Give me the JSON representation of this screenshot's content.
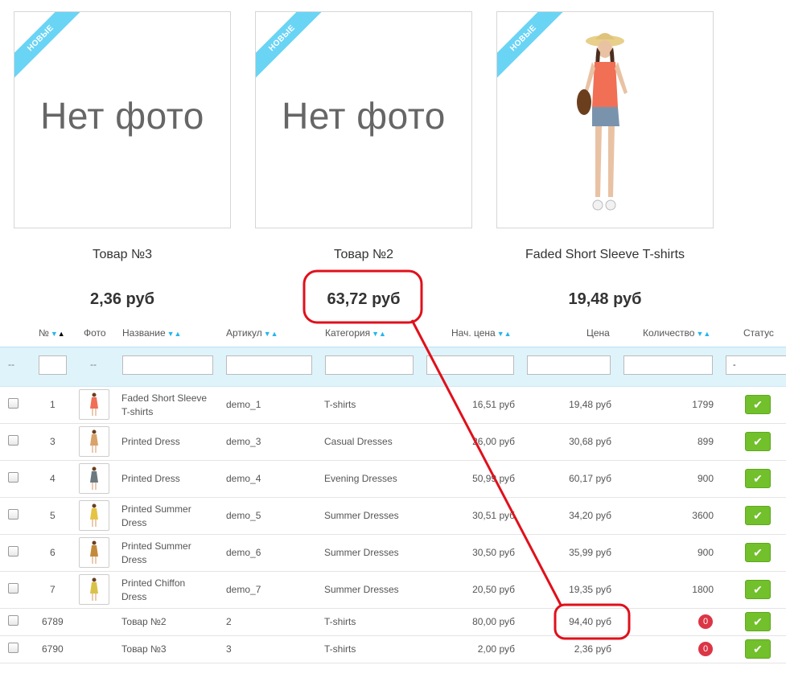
{
  "ribbon_label": "НОВЫЕ",
  "cards": [
    {
      "name": "Товар №3",
      "price": "2,36 руб",
      "photo": "Нет фото"
    },
    {
      "name": "Товар №2",
      "price": "63,72 руб",
      "photo": "Нет фото"
    },
    {
      "name": "Faded Short Sleeve T-shirts",
      "price": "19,48 руб",
      "photo": ""
    }
  ],
  "table": {
    "headers": {
      "num": "№",
      "photo": "Фото",
      "name": "Название",
      "sku": "Артикул",
      "category": "Категория",
      "base_price": "Нач. цена",
      "price": "Цена",
      "quantity": "Количество",
      "status": "Статус"
    },
    "filter": {
      "dash1": "--",
      "dash2": "--",
      "status": "-"
    },
    "rows": [
      {
        "id": "1",
        "name1": "Faded Short Sleeve",
        "name2": "T-shirts",
        "sku": "demo_1",
        "category": "T-shirts",
        "base": "16,51 руб",
        "price": "19,48 руб",
        "qty": "1799"
      },
      {
        "id": "3",
        "name1": "Printed Dress",
        "name2": "",
        "sku": "demo_3",
        "category": "Casual Dresses",
        "base": "26,00 руб",
        "price": "30,68 руб",
        "qty": "899"
      },
      {
        "id": "4",
        "name1": "Printed Dress",
        "name2": "",
        "sku": "demo_4",
        "category": "Evening Dresses",
        "base": "50,99 руб",
        "price": "60,17 руб",
        "qty": "900"
      },
      {
        "id": "5",
        "name1": "Printed Summer",
        "name2": "Dress",
        "sku": "demo_5",
        "category": "Summer Dresses",
        "base": "30,51 руб",
        "price": "34,20 руб",
        "qty": "3600"
      },
      {
        "id": "6",
        "name1": "Printed Summer",
        "name2": "Dress",
        "sku": "demo_6",
        "category": "Summer Dresses",
        "base": "30,50 руб",
        "price": "35,99 руб",
        "qty": "900"
      },
      {
        "id": "7",
        "name1": "Printed Chiffon",
        "name2": "Dress",
        "sku": "demo_7",
        "category": "Summer Dresses",
        "base": "20,50 руб",
        "price": "19,35 руб",
        "qty": "1800"
      },
      {
        "id": "6789",
        "name1": "Товар №2",
        "name2": "",
        "sku": "2",
        "category": "T-shirts",
        "base": "80,00 руб",
        "price": "94,40 руб",
        "qty": "0"
      },
      {
        "id": "6790",
        "name1": "Товар №3",
        "name2": "",
        "sku": "3",
        "category": "T-shirts",
        "base": "2,00 руб",
        "price": "2,36 руб",
        "qty": "0"
      }
    ]
  },
  "colors": {
    "accent": "#25b6ea",
    "ok": "#72c02c",
    "alert": "#dc3545",
    "annotation": "#e0101b"
  }
}
